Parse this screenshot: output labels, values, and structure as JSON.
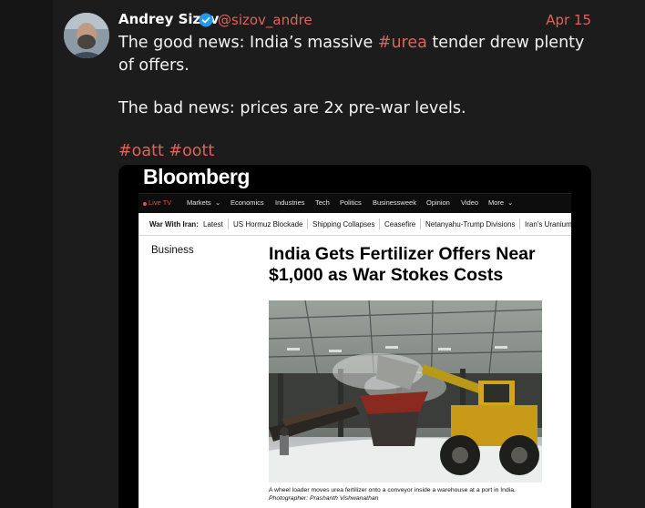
{
  "author": {
    "name": "Andrey Sizov",
    "handle": "@sizov_andre",
    "date": "Apr 15"
  },
  "tweet": {
    "line1_pre": "The good news: India’s massive ",
    "line1_tag": "#urea",
    "line1_post": " tender drew plenty of offers.",
    "line2": "The bad news: prices are 2x pre-war levels.",
    "tag1": "#oatt",
    "tag2": "#oott"
  },
  "embed": {
    "logo": "Bloomberg",
    "nav": [
      "Live TV",
      "Markets",
      "Economics",
      "Industries",
      "Tech",
      "Politics",
      "Businessweek",
      "Opinion",
      "Video",
      "More"
    ],
    "subnav_label": "War With Iran:",
    "subnav": [
      "Latest",
      "US Hormuz Blockade",
      "Shipping Collapses",
      "Ceasefire",
      "Netanyahu-Trump Divisions",
      "Iran's Uranium"
    ],
    "section": "Business",
    "headline": "India Gets Fertilizer Offers Near $1,000 as War Stokes Costs",
    "caption": "A wheel loader moves urea fertilizer onto a conveyor inside a warehouse at a port in India.",
    "credit": "Photographer: Prashanth Vishwanathan"
  },
  "colors": {
    "accent": "#e0625b",
    "verified": "#1d9bf0",
    "live": "#e2504c"
  },
  "icons": [
    "verified-badge-icon",
    "chevron-down-icon"
  ]
}
